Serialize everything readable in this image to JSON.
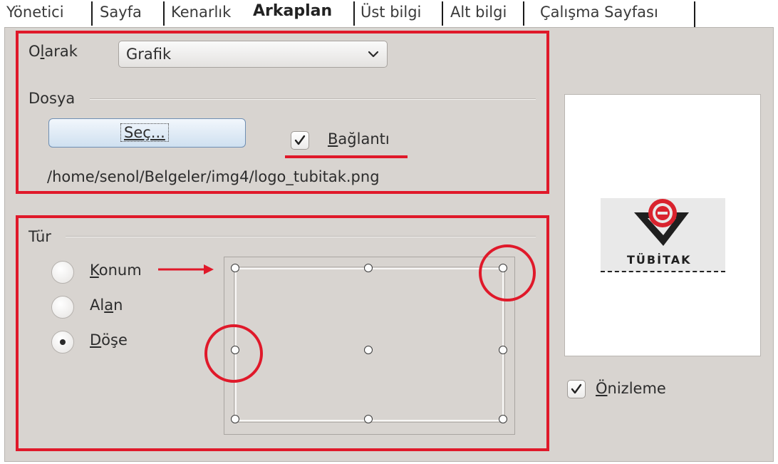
{
  "tabs": [
    {
      "label": "Yönetici",
      "active": false
    },
    {
      "label": "Sayfa",
      "active": false
    },
    {
      "label": "Kenarlık",
      "active": false
    },
    {
      "label": "Arkaplan",
      "active": true
    },
    {
      "label": "Üst bilgi",
      "active": false
    },
    {
      "label": "Alt bilgi",
      "active": false
    },
    {
      "label": "Çalışma Sayfası",
      "active": false
    }
  ],
  "background": {
    "as_label_pre": "O",
    "as_label_ul": "l",
    "as_label_post": "arak",
    "as_value": "Grafik",
    "file_section": "Dosya",
    "browse_pre": "",
    "browse_ul": "Seç...",
    "link_checked": true,
    "link_ul": "B",
    "link_post": "ağlantı",
    "file_path": "/home/senol/Belgeler/img4/logo_tubitak.png"
  },
  "type_section": {
    "title": "Tür",
    "options": [
      {
        "ul": "K",
        "post": "onum",
        "selected": false
      },
      {
        "pre": "Al",
        "ul": "a",
        "post": "n",
        "selected": false
      },
      {
        "ul": "D",
        "post": "öşe",
        "selected": true
      }
    ]
  },
  "preview": {
    "logo_text": "TÜBİTAK",
    "checkbox_checked": true,
    "checkbox_ul": "Ö",
    "checkbox_post": "nizleme"
  },
  "colors": {
    "annotation_red": "#e0192a",
    "panel_bg": "#d8d4d0"
  }
}
